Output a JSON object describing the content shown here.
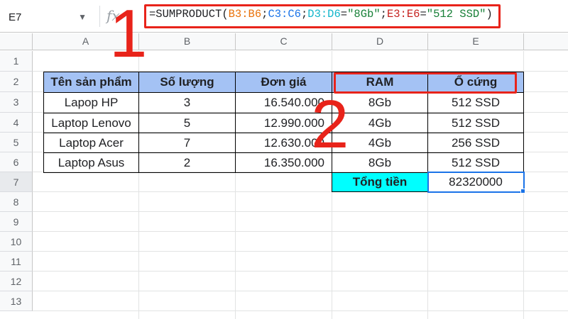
{
  "name_box": "E7",
  "fx_symbol": "fx",
  "formula": {
    "prefix": "=SUMPRODUCT(",
    "arg1": "B3:B6",
    "sep": ";",
    "arg2": "C3:C6",
    "arg3": "D3:D6",
    "eq": "=",
    "str1": "\"8Gb\"",
    "arg4": "E3:E6",
    "str2": "\"512 SSD\"",
    "suffix": ")"
  },
  "columns": [
    "A",
    "B",
    "C",
    "D",
    "E"
  ],
  "rows": [
    "1",
    "2",
    "3",
    "4",
    "5",
    "6",
    "7",
    "8",
    "9",
    "10",
    "11",
    "12",
    "13"
  ],
  "table": {
    "headers": [
      "Tên sản phẩm",
      "Số lượng",
      "Đơn giá",
      "RAM",
      "Ổ cứng"
    ],
    "data": [
      [
        "Lapop HP",
        "3",
        "16.540.000",
        "8Gb",
        "512 SSD"
      ],
      [
        "Laptop Lenovo",
        "5",
        "12.990.000",
        "4Gb",
        "512 SSD"
      ],
      [
        "Laptop Acer",
        "7",
        "12.630.000",
        "4Gb",
        "256 SSD"
      ],
      [
        "Laptop Asus",
        "2",
        "16.350.000",
        "8Gb",
        "512 SSD"
      ]
    ],
    "total_label": "Tổng tiền",
    "total_value": "82320000"
  },
  "annotations": [
    "1",
    "2"
  ],
  "colors": {
    "header_fill": "#a4c2f4",
    "total_label_fill": "#00ffff",
    "annotation_red": "#e8231a",
    "selection_blue": "#1a73e8"
  }
}
